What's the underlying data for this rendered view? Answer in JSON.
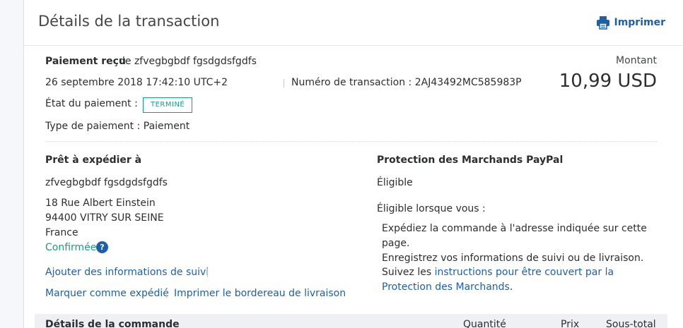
{
  "header": {
    "title": "Détails de la transaction",
    "print_label": "Imprimer"
  },
  "payment": {
    "received_label": "Paiement reçu",
    "received_from": "de zfvegbgbdf fgsdgdsfgdfs",
    "datetime": "26 septembre 2018 17:42:10 UTC+2",
    "transaction_id_text": "Numéro de transaction : 2AJ43492MC585983P",
    "state_label": "État du paiement :",
    "state_badge": "TERMINÉ",
    "type_text": "Type de paiement : Paiement",
    "amount_label": "Montant",
    "amount_value": "10,99 USD"
  },
  "shipping": {
    "title": "Prêt à expédier à",
    "name": "zfvegbgbdf fgsdgdsfgdfs",
    "address_line1": "18 Rue Albert Einstein",
    "address_line2": "94400 VITRY SUR SEINE",
    "country": "France",
    "confirmed": "Confirmée",
    "add_tracking": "Ajouter des informations de suivi",
    "mark_shipped": "Marquer comme expédié",
    "print_label": "Imprimer le bordereau de livraison"
  },
  "protection": {
    "title": "Protection des Marchands PayPal",
    "status": "Éligible",
    "condition_intro": "Éligible lorsque vous :",
    "item1_line1": "Expédiez la commande à l'adresse indiquée sur cette",
    "item1_line2": "page.",
    "item2": "Enregistrez vos informations de suivi ou de livraison.",
    "item3_prefix": "Suivez les",
    "item3_link1": "instructions pour être couvert par la",
    "item3_link2": "Protection des Marchands",
    "item3_suffix": "."
  },
  "order": {
    "title": "Détails de la commande",
    "col_quantity": "Quantité",
    "col_price": "Prix",
    "col_subtotal": "Sous-total"
  },
  "colors": {
    "link": "#1f5fa8",
    "status_green": "#1a9c84"
  }
}
